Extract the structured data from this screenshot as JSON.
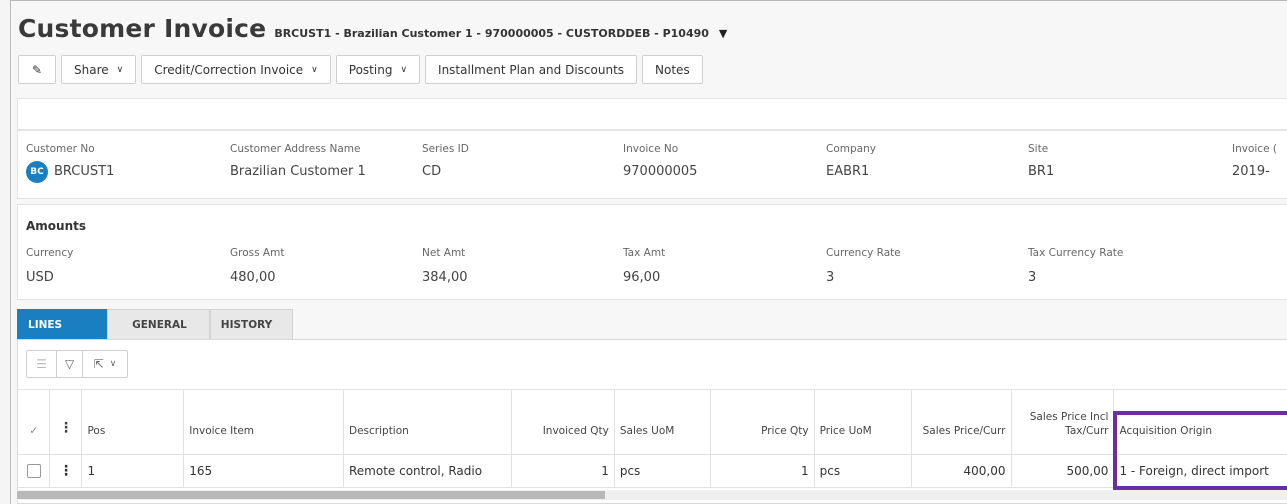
{
  "header": {
    "title": "Customer Invoice",
    "subtitle": "BRCUST1 - Brazilian Customer 1 - 970000005 - CUSTORDDEB - P10490"
  },
  "toolbar": {
    "edit_icon": "pencil-icon",
    "share": "Share",
    "credit": "Credit/Correction Invoice",
    "posting": "Posting",
    "installment": "Installment Plan and Discounts",
    "notes": "Notes"
  },
  "info": {
    "customer_no_label": "Customer No",
    "customer_no": "BRCUST1",
    "avatar_initials": "BC",
    "address_name_label": "Customer Address Name",
    "address_name": "Brazilian Customer 1",
    "series_label": "Series ID",
    "series": "CD",
    "invoice_no_label": "Invoice No",
    "invoice_no": "970000005",
    "company_label": "Company",
    "company": "EABR1",
    "site_label": "Site",
    "site": "BR1",
    "invoice_date_label": "Invoice (",
    "invoice_date": "2019-"
  },
  "amounts": {
    "title": "Amounts",
    "currency_label": "Currency",
    "currency": "USD",
    "gross_label": "Gross Amt",
    "gross": "480,00",
    "net_label": "Net Amt",
    "net": "384,00",
    "tax_label": "Tax Amt",
    "tax": "96,00",
    "rate_label": "Currency Rate",
    "rate": "3",
    "tax_rate_label": "Tax Currency Rate",
    "tax_rate": "3"
  },
  "tabs": [
    "LINES",
    "GENERAL",
    "HISTORY"
  ],
  "table": {
    "headers": {
      "pos": "Pos",
      "item": "Invoice Item",
      "desc": "Description",
      "qty": "Invoiced Qty",
      "uom": "Sales UoM",
      "price_qty": "Price Qty",
      "price_uom": "Price UoM",
      "sales_price": "Sales Price/Curr",
      "incl_tax_1": "Sales Price Incl",
      "incl_tax_2": "Tax/Curr",
      "acq": "Acquisition Origin"
    },
    "row": {
      "pos": "1",
      "item": "165",
      "desc": "Remote control, Radio",
      "qty": "1",
      "uom": "pcs",
      "price_qty": "1",
      "price_uom": "pcs",
      "sales_price": "400,00",
      "incl_tax": "500,00",
      "acq": "1 - Foreign, direct import"
    }
  },
  "colors": {
    "accent": "#1a7fc1",
    "highlight": "#6a2fa3"
  }
}
